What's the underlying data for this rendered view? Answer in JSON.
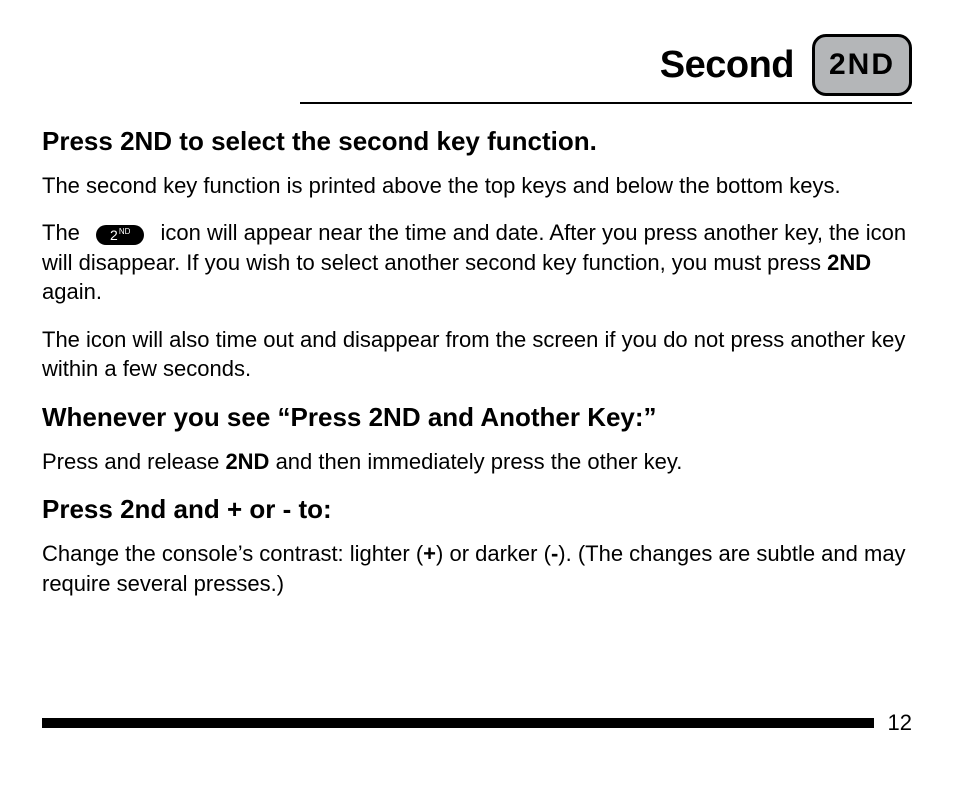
{
  "header": {
    "title": "Second",
    "key_label": "2ND"
  },
  "section1": {
    "heading": "Press 2ND to select the second key function.",
    "para1": "The second key function is printed above the top keys and below the bottom keys.",
    "para2_pre": "The ",
    "icon_main": "2",
    "icon_sup": "ND",
    "para2_post": " icon will appear near the time and date. After you press another key, the icon will disappear. If you wish to select another second key function, you must press ",
    "para2_bold": "2ND",
    "para2_end": " again.",
    "para3": "The icon will also time out and disappear from the screen if you do not press another key within a few seconds."
  },
  "section2": {
    "heading": "Whenever you see “Press 2ND and Another Key:”",
    "para_pre": "Press and release ",
    "para_bold": "2ND",
    "para_post": " and then immediately press the other key."
  },
  "section3": {
    "heading": "Press 2nd and + or - to:",
    "para_pre": "Change the console’s contrast: lighter (",
    "plus": "+",
    "mid1": ") or darker (",
    "minus": "-",
    "para_post": "). (The changes are subtle and may require several presses.)"
  },
  "footer": {
    "page_number": "12"
  }
}
